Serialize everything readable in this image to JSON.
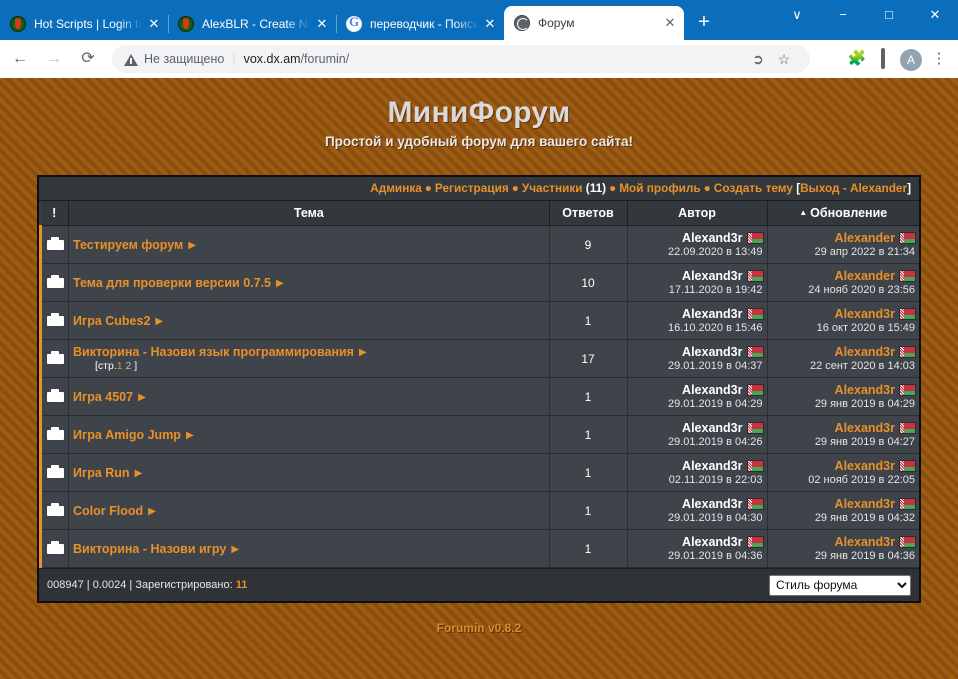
{
  "browser": {
    "tabs": [
      {
        "title": "Hot Scripts | Login to",
        "icon": "chili-pepper-icon",
        "active": false
      },
      {
        "title": "AlexBLR - Create New",
        "icon": "chili-pepper-icon",
        "active": false
      },
      {
        "title": "переводчик - Поиск",
        "icon": "google-icon",
        "active": false
      },
      {
        "title": "Форум",
        "icon": "globe-icon",
        "active": true
      }
    ],
    "new_tab_label": "+",
    "window_controls": [
      "∨",
      "−",
      "□",
      "✕"
    ],
    "nav": {
      "back": "←",
      "forward": "→",
      "reload": "⟳"
    },
    "omnibox": {
      "security_label": "Не защищено",
      "separator": "|",
      "url_domain": "vox.dx.am",
      "url_path": "/forumin/",
      "share_icon": "share-icon",
      "bookmark_icon": "star-icon"
    },
    "toolbar_icons": [
      "extension-glasses-icon",
      "puzzle-icon",
      "side-panel-icon"
    ],
    "avatar_letter": "A",
    "menu_icon": "⋮"
  },
  "site": {
    "title": "МиниФорум",
    "subtitle": "Простой и удобный форум для вашего сайта!",
    "footer": "Forumin v0.8.2"
  },
  "navbar": {
    "links": [
      {
        "label": "Админка"
      },
      {
        "label": "Регистрация"
      },
      {
        "label": "Участники",
        "count": "(11)"
      },
      {
        "label": "Мой профиль"
      },
      {
        "label": "Создать тему"
      }
    ],
    "separator": "●",
    "session_prefix": "[",
    "logout_label": "Выход - Alexander",
    "session_suffix": "]"
  },
  "table": {
    "headers": {
      "flag": "!",
      "topic": "Тема",
      "replies": "Ответов",
      "author": "Автор",
      "update": "Обновление",
      "sort_arrow": "▲"
    },
    "rows": [
      {
        "hot": true,
        "icon": "folder-icon",
        "topic": "Тестируем форум",
        "arrow": "▶",
        "pages": null,
        "replies": "9",
        "author": "Alexand3r",
        "author_flag": "belarus-flag-icon",
        "author_time": "22.09.2020 в 13:49",
        "updater": "Alexander",
        "updater_flag": "belarus-flag-icon",
        "update_time": "29 апр 2022 в 21:34"
      },
      {
        "hot": true,
        "icon": "folder-icon",
        "topic": "Тема для проверки версии 0.7.5",
        "arrow": "▶",
        "pages": null,
        "replies": "10",
        "author": "Alexand3r",
        "author_flag": "belarus-flag-icon",
        "author_time": "17.11.2020 в 19:42",
        "updater": "Alexander",
        "updater_flag": "belarus-flag-icon",
        "update_time": "24 нояб 2020 в 23:56"
      },
      {
        "hot": true,
        "icon": "folder-icon",
        "topic": "Игра Cubes2",
        "arrow": "▶",
        "pages": null,
        "replies": "1",
        "author": "Alexand3r",
        "author_flag": "belarus-flag-icon",
        "author_time": "16.10.2020 в 15:46",
        "updater": "Alexand3r",
        "updater_flag": "belarus-flag-icon",
        "update_time": "16 окт 2020 в 15:49"
      },
      {
        "hot": true,
        "icon": "folder-icon",
        "topic": "Викторина - Назови язык программирования",
        "arrow": "▶",
        "pages": {
          "prefix": "[стр.",
          "current": "1",
          "other": "2",
          "suffix": "]"
        },
        "replies": "17",
        "author": "Alexand3r",
        "author_flag": "belarus-flag-icon",
        "author_time": "29.01.2019 в 04:37",
        "updater": "Alexand3r",
        "updater_flag": "belarus-flag-icon",
        "update_time": "22 сент 2020 в 14:03"
      },
      {
        "hot": true,
        "icon": "folder-icon",
        "topic": "Игра 4507",
        "arrow": "▶",
        "pages": null,
        "replies": "1",
        "author": "Alexand3r",
        "author_flag": "belarus-flag-icon",
        "author_time": "29.01.2019 в 04:29",
        "updater": "Alexand3r",
        "updater_flag": "belarus-flag-icon",
        "update_time": "29 янв 2019 в 04:29"
      },
      {
        "hot": true,
        "icon": "folder-icon",
        "topic": "Игра Amigo Jump",
        "arrow": "▶",
        "pages": null,
        "replies": "1",
        "author": "Alexand3r",
        "author_flag": "belarus-flag-icon",
        "author_time": "29.01.2019 в 04:26",
        "updater": "Alexand3r",
        "updater_flag": "belarus-flag-icon",
        "update_time": "29 янв 2019 в 04:27"
      },
      {
        "hot": true,
        "icon": "folder-icon",
        "topic": "Игра Run",
        "arrow": "▶",
        "pages": null,
        "replies": "1",
        "author": "Alexand3r",
        "author_flag": "belarus-flag-icon",
        "author_time": "02.11.2019 в 22:03",
        "updater": "Alexand3r",
        "updater_flag": "belarus-flag-icon",
        "update_time": "02 нояб 2019 в 22:05"
      },
      {
        "hot": true,
        "icon": "folder-icon",
        "topic": "Color Flood",
        "arrow": "▶",
        "pages": null,
        "replies": "1",
        "author": "Alexand3r",
        "author_flag": "belarus-flag-icon",
        "author_time": "29.01.2019 в 04:30",
        "updater": "Alexand3r",
        "updater_flag": "belarus-flag-icon",
        "update_time": "29 янв 2019 в 04:32"
      },
      {
        "hot": true,
        "icon": "folder-icon",
        "topic": "Викторина - Назови игру",
        "arrow": "▶",
        "pages": null,
        "replies": "1",
        "author": "Alexand3r",
        "author_flag": "belarus-flag-icon",
        "author_time": "29.01.2019 в 04:36",
        "updater": "Alexand3r",
        "updater_flag": "belarus-flag-icon",
        "update_time": "29 янв 2019 в 04:36"
      }
    ]
  },
  "footer": {
    "counter": "008947",
    "sep1": "|",
    "gen_time": "0.0024",
    "sep2": "|",
    "registered_label": "Зарегистрировано:",
    "registered_count": "11",
    "style_select": {
      "selected": "Стиль форума",
      "options": [
        "Стиль форума"
      ]
    }
  },
  "colors": {
    "accent": "#e8902a",
    "page_bg": "#9a5a14",
    "board_bg": "#3f444a",
    "header_bg": "#33383d",
    "chrome_blue": "#0a6ebd"
  }
}
